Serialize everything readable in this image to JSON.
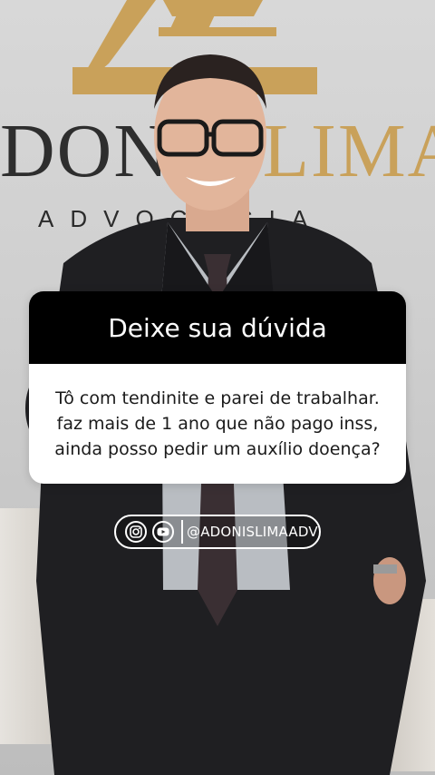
{
  "brand": {
    "name_dark": "DONIS ",
    "name_gold": "LIMA",
    "subtitle": "ADVOCACIA",
    "logo_icon": "adonis-lima-logo-mark",
    "colors": {
      "gold": "#c9a15a",
      "dark": "#2e2e2e"
    }
  },
  "question_card": {
    "title": "Deixe sua dúvida",
    "lines": [
      "Tô com tendinite e parei de trabalhar.",
      "faz mais de 1 ano que não pago inss,",
      "ainda posso pedir um auxílio doença?"
    ]
  },
  "social": {
    "icons": [
      "instagram-icon",
      "youtube-icon"
    ],
    "handle": "@ADONISLIMAADV"
  }
}
